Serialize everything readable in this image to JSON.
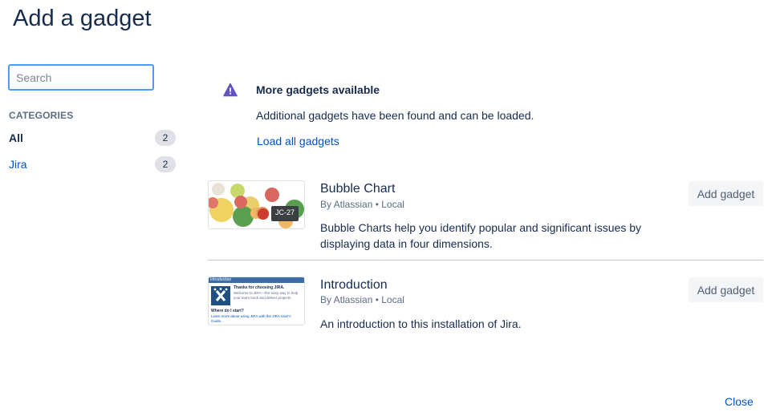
{
  "dialog": {
    "title": "Add a gadget"
  },
  "search": {
    "placeholder": "Search",
    "value": ""
  },
  "categories": {
    "heading": "CATEGORIES",
    "items": [
      {
        "label": "All",
        "count": "2"
      },
      {
        "label": "Jira",
        "count": "2"
      }
    ]
  },
  "notice": {
    "icon": "warning-icon",
    "title": "More gadgets available",
    "body": "Additional gadgets have been found and can be loaded.",
    "link": "Load all gadgets"
  },
  "gadgets": [
    {
      "title": "Bubble Chart",
      "meta": "By Atlassian • Local",
      "description": "Bubble Charts help you identify popular and significant issues by displaying data in four dimensions.",
      "button": "Add gadget",
      "thumbnail": {
        "tooltip": "JC-27"
      }
    },
    {
      "title": "Introduction",
      "meta": "By Atlassian • Local",
      "description": "An introduction to this installation of Jira.",
      "button": "Add gadget",
      "thumbnail": {
        "header": "Introduction",
        "heading": "Thanks for choosing JIRA.",
        "body": "Welcome to JIRA—the easy way to help your team track and deliver projects.",
        "subheading": "Where do I start?",
        "footer": "Learn more about using JIRA with the JIRA User's Guide."
      }
    }
  ],
  "footer": {
    "close": "Close"
  },
  "colors": {
    "text": "#172b4d",
    "link": "#0052cc",
    "warning": "#6554c0",
    "focus": "#4c9aff"
  }
}
